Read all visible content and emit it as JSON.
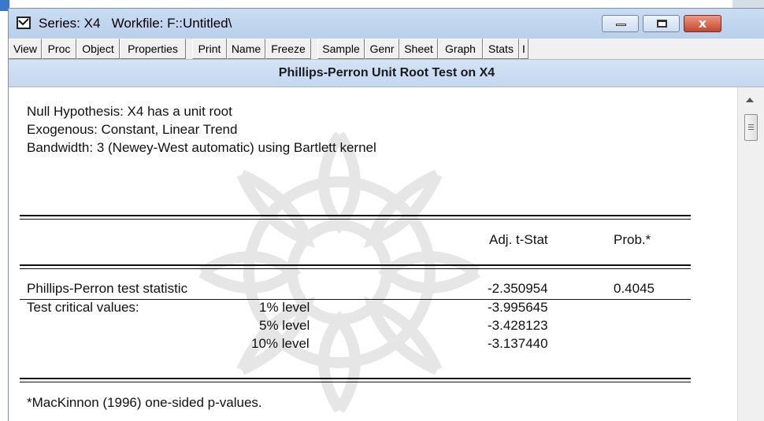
{
  "window": {
    "title": "Series: X4   Workfile: F::Untitled\\",
    "controls": {
      "minimize": "minimize",
      "maximize": "maximize",
      "close": "x"
    }
  },
  "toolbar": {
    "buttons": [
      "View",
      "Proc",
      "Object",
      "Properties",
      "Print",
      "Name",
      "Freeze",
      "Sample",
      "Genr",
      "Sheet",
      "Graph",
      "Stats",
      "I"
    ]
  },
  "header": {
    "title": "Phillips-Perron Unit Root Test on X4"
  },
  "output": {
    "null_hypothesis": "Null Hypothesis: X4 has a unit root",
    "exogenous": "Exogenous: Constant, Linear Trend",
    "bandwidth": "Bandwidth: 3 (Newey-West automatic) using Bartlett kernel",
    "col_adj_tstat": "Adj. t-Stat",
    "col_prob": "Prob.*",
    "pp_label": "Phillips-Perron test statistic",
    "pp_tstat": "-2.350954",
    "pp_prob": "0.4045",
    "critical_label": "Test critical values:",
    "levels": [
      {
        "label": "1% level",
        "value": "-3.995645"
      },
      {
        "label": "5% level",
        "value": "-3.428123"
      },
      {
        "label": "10% level",
        "value": "-3.137440"
      }
    ],
    "footnote": "*MacKinnon (1996) one-sided p-values."
  },
  "icons": {
    "window_icon": "checkbox-icon",
    "scroll_up": "scroll-up-arrow-icon",
    "watermark": "watermark-icon"
  },
  "colors": {
    "title_bar": "#b8d0ec",
    "close_button": "#c7452c",
    "header_band": "#c3d7ef"
  }
}
